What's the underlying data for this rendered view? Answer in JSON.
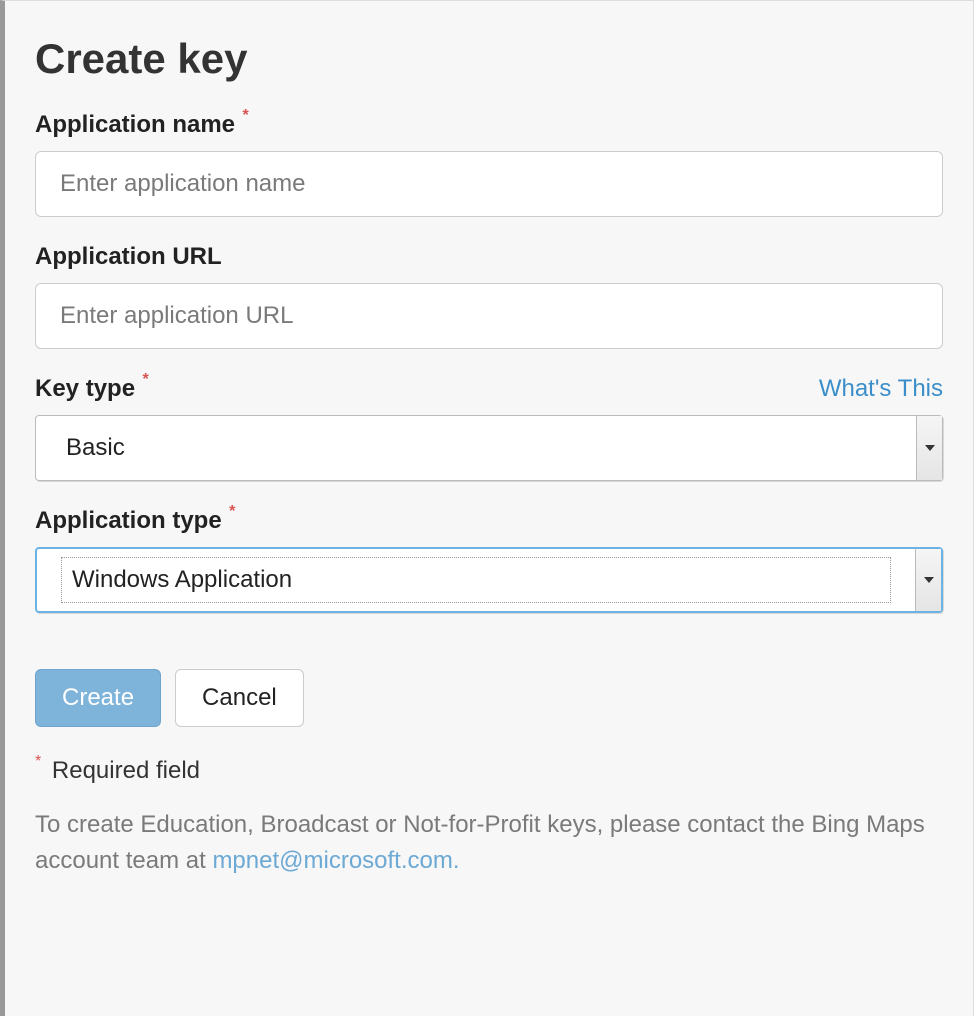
{
  "title": "Create key",
  "fields": {
    "app_name": {
      "label": "Application name",
      "required": true,
      "placeholder": "Enter application name",
      "value": ""
    },
    "app_url": {
      "label": "Application URL",
      "required": false,
      "placeholder": "Enter application URL",
      "value": ""
    },
    "key_type": {
      "label": "Key type",
      "required": true,
      "help_link": "What's This",
      "value": "Basic"
    },
    "app_type": {
      "label": "Application type",
      "required": true,
      "value": "Windows Application"
    }
  },
  "buttons": {
    "create": "Create",
    "cancel": "Cancel"
  },
  "required_note": "Required field",
  "info": {
    "text_prefix": "To create Education, Broadcast or Not-for-Profit keys, please contact the Bing Maps account team at ",
    "link_text": "mpnet@microsoft.com."
  },
  "star": "*"
}
